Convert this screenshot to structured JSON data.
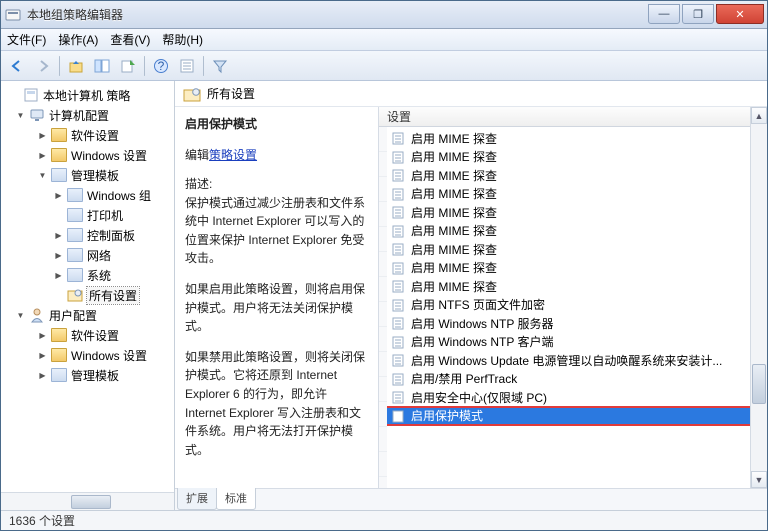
{
  "title": "本地组策略编辑器",
  "menu": {
    "file": "文件(F)",
    "action": "操作(A)",
    "view": "查看(V)",
    "help": "帮助(H)"
  },
  "tree": {
    "root": "本地计算机 策略",
    "computer": "计算机配置",
    "software": "软件设置",
    "windows": "Windows 设置",
    "templates": "管理模板",
    "windows_components": "Windows 组",
    "printers": "打印机",
    "control_panel": "控制面板",
    "network": "网络",
    "system": "系统",
    "all_settings": "所有设置",
    "user": "用户配置",
    "u_software": "软件设置",
    "u_windows": "Windows 设置",
    "u_templates": "管理模板"
  },
  "pane": {
    "header": "所有设置",
    "title": "启用保护模式",
    "edit_prefix": "编辑",
    "edit_link": "策略设置",
    "desc_label": "描述:",
    "p1": "保护模式通过减少注册表和文件系统中 Internet Explorer 可以写入的位置来保护 Internet Explorer 免受攻击。",
    "p2": "如果启用此策略设置，则将启用保护模式。用户将无法关闭保护模式。",
    "p3": "如果禁用此策略设置，则将关闭保护模式。它将还原到 Internet Explorer 6 的行为，即允许 Internet Explorer 写入注册表和文件系统。用户将无法打开保护模式。"
  },
  "grid": {
    "header": "设置",
    "rows": [
      "启用 MIME 探查",
      "启用 MIME 探查",
      "启用 MIME 探查",
      "启用 MIME 探查",
      "启用 MIME 探查",
      "启用 MIME 探查",
      "启用 MIME 探查",
      "启用 MIME 探查",
      "启用 MIME 探查",
      "启用 NTFS 页面文件加密",
      "启用 Windows NTP 服务器",
      "启用 Windows NTP 客户端",
      "启用 Windows Update 电源管理以自动唤醒系统来安装计...",
      "启用/禁用 PerfTrack",
      "启用安全中心(仅限域 PC)"
    ],
    "selected": "启用保护模式"
  },
  "tabs": {
    "extended": "扩展",
    "standard": "标准"
  },
  "status": "1636 个设置"
}
